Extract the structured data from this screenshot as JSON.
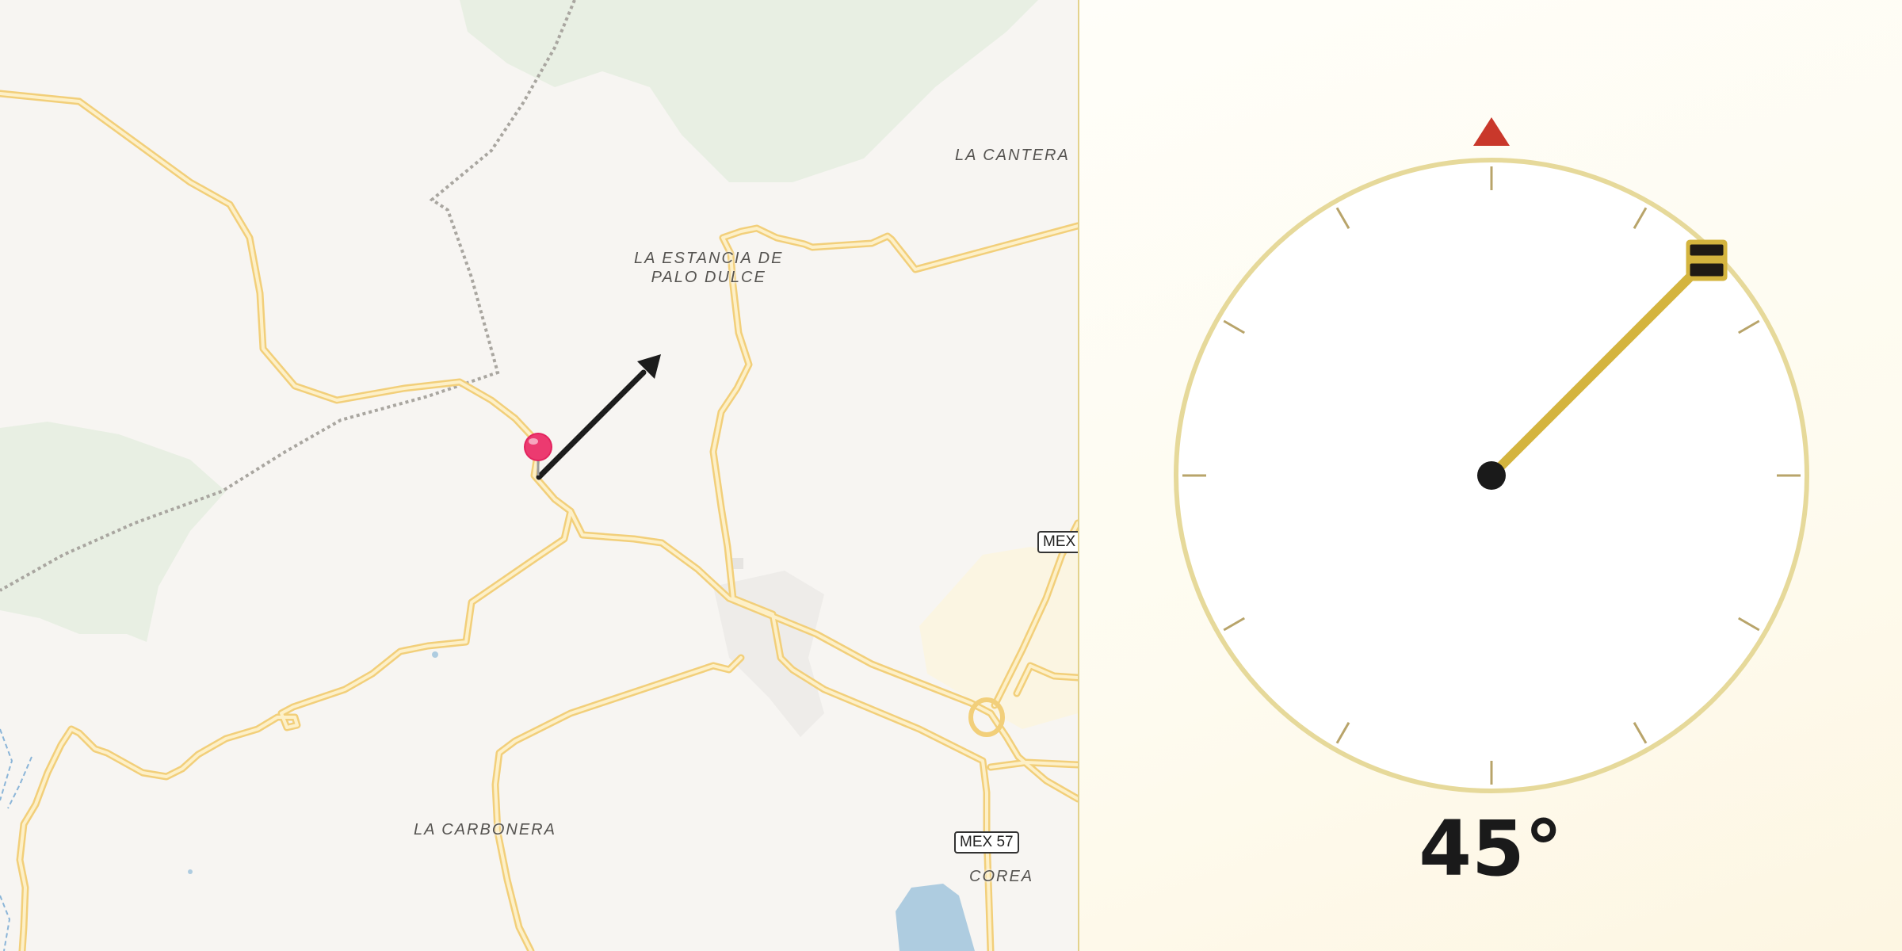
{
  "map": {
    "places": [
      {
        "name": "LA CANTERA"
      },
      {
        "name": "LA ESTANCIA DE\nPALO DULCE"
      },
      {
        "name": "LA CARBONERA"
      },
      {
        "name": "COREA"
      }
    ],
    "shields": [
      {
        "label": "MEX"
      },
      {
        "label": "MEX 57"
      }
    ],
    "marker_icon": "red-map-pin",
    "direction_icon": "black-arrow"
  },
  "compass": {
    "heading_deg": 45,
    "heading_label": "45°",
    "north_marker_icon": "red-triangle",
    "colors": {
      "ring": "#e6d99a",
      "needle": "#d4b43e",
      "north": "#c9382b",
      "ticks": "#b8a46a"
    }
  }
}
